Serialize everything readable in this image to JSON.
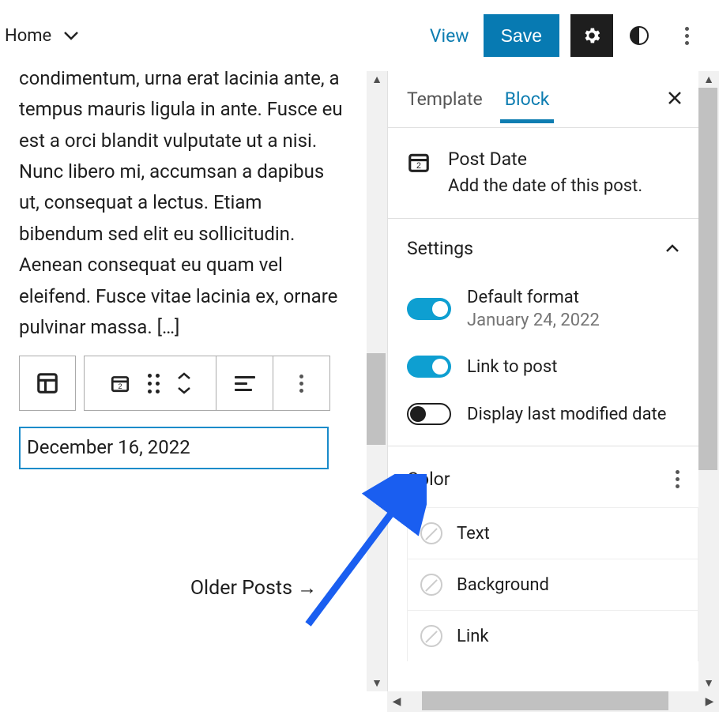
{
  "topbar": {
    "home_label": "Home",
    "view_label": "View",
    "save_label": "Save"
  },
  "editor": {
    "body": "condimentum, urna erat lacinia ante, a tempus mauris ligula in ante. Fusce eu est a orci blandit vulputate ut a nisi. Nunc libero mi, accumsan a dapibus ut, consequat a lectus. Etiam bibendum sed elit eu sollicitudin. Aenean consequat eu quam vel eleifend. Fusce vitae lacinia ex, ornare pulvinar massa. […]",
    "date_field": "December 16, 2022",
    "older_posts": "Older Posts  →"
  },
  "sidebar": {
    "tabs": {
      "template": "Template",
      "block": "Block"
    },
    "block_title": "Post Date",
    "block_desc": "Add the date of this post.",
    "settings_label": "Settings",
    "settings": {
      "default_format_label": "Default format",
      "default_format_sub": "January 24, 2022",
      "link_label": "Link to post",
      "modified_label": "Display last modified date"
    },
    "color_label": "Color",
    "colors": {
      "text": "Text",
      "background": "Background",
      "link": "Link"
    }
  }
}
